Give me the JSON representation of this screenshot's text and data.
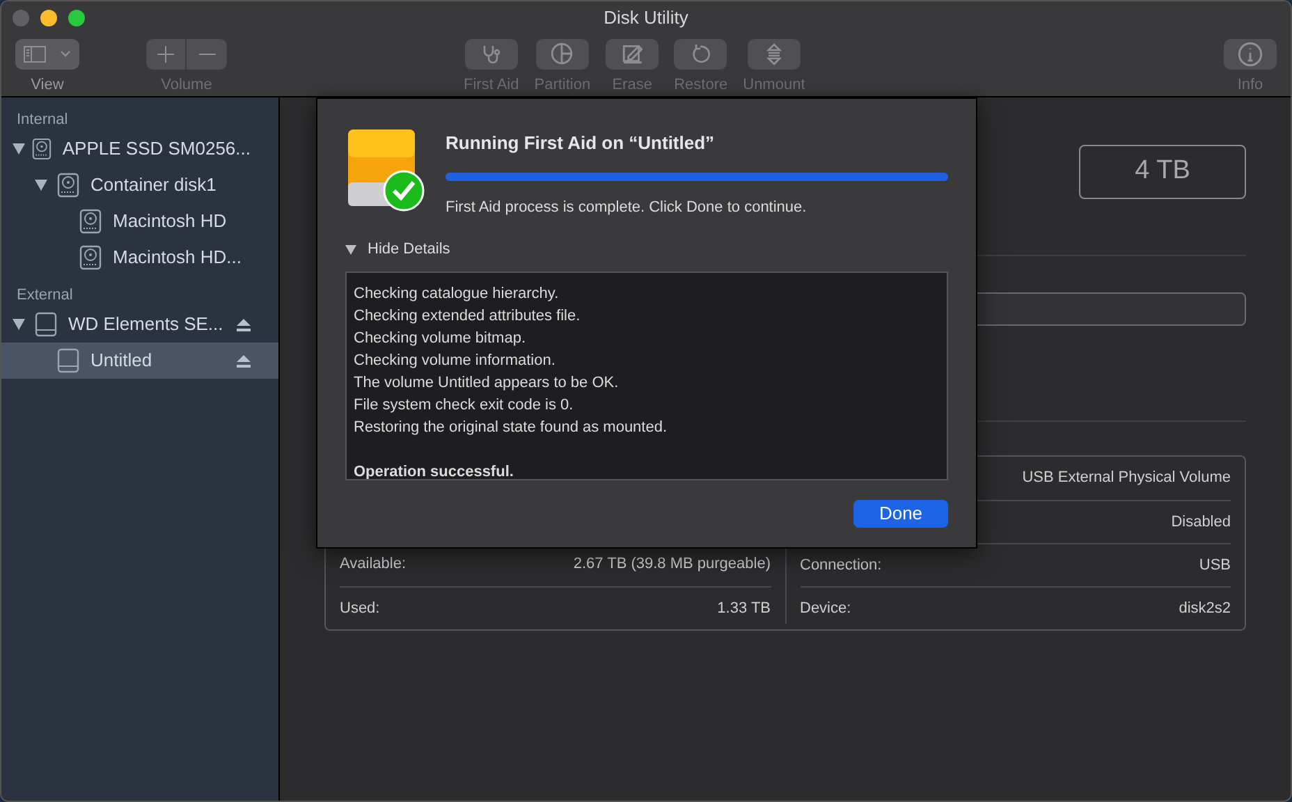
{
  "window": {
    "title": "Disk Utility"
  },
  "toolbar": [
    {
      "kind": "view",
      "label": "View",
      "disabled": false
    },
    {
      "kind": "volume",
      "label": "Volume",
      "disabled": true
    },
    {
      "kind": "firstaid",
      "label": "First Aid",
      "disabled": true
    },
    {
      "kind": "partition",
      "label": "Partition",
      "disabled": true
    },
    {
      "kind": "erase",
      "label": "Erase",
      "disabled": true
    },
    {
      "kind": "restore",
      "label": "Restore",
      "disabled": true
    },
    {
      "kind": "unmount",
      "label": "Unmount",
      "disabled": true
    },
    {
      "kind": "info",
      "label": "Info",
      "disabled": true
    }
  ],
  "sidebar": {
    "sections": [
      {
        "title": "Internal",
        "items": [
          {
            "label": "APPLE SSD SM0256...",
            "kind": "internal",
            "expanded": true,
            "selected": false,
            "eject": false,
            "children": [
              {
                "label": "Container disk1",
                "kind": "internal",
                "expanded": true,
                "selected": false,
                "eject": false,
                "children": [
                  {
                    "label": "Macintosh HD",
                    "kind": "internal",
                    "selected": false,
                    "eject": false
                  },
                  {
                    "label": "Macintosh HD...",
                    "kind": "internal",
                    "selected": false,
                    "eject": false
                  }
                ]
              }
            ]
          }
        ]
      },
      {
        "title": "External",
        "items": [
          {
            "label": "WD Elements SE...",
            "kind": "external",
            "expanded": true,
            "selected": false,
            "eject": true,
            "children": [
              {
                "label": "Untitled",
                "kind": "external",
                "selected": true,
                "eject": true
              }
            ]
          }
        ]
      }
    ]
  },
  "main": {
    "capacity": "4 TB",
    "info_left": [
      {
        "label": "Available:",
        "value": "2.67 TB (39.8 MB purgeable)"
      },
      {
        "label": "Used:",
        "value": "1.33 TB"
      }
    ],
    "info_right": [
      {
        "value": "USB External Physical Volume"
      },
      {
        "value": "Disabled"
      },
      {
        "label": "Connection:",
        "value": "USB"
      },
      {
        "label": "Device:",
        "value": "disk2s2"
      }
    ]
  },
  "dialog": {
    "title": "Running First Aid on “Untitled”",
    "level": 1,
    "message": "First Aid process is complete. Click Done to continue.",
    "details_toggle": "Hide Details",
    "details_expanded": true,
    "log": [
      {
        "text": "Checking catalogue hierarchy.",
        "bold": false
      },
      {
        "text": "Checking extended attributes file.",
        "bold": false
      },
      {
        "text": "Checking volume bitmap.",
        "bold": false
      },
      {
        "text": "Checking volume information.",
        "bold": false
      },
      {
        "text": "The volume Untitled appears to be OK.",
        "bold": false
      },
      {
        "text": "File system check exit code is 0.",
        "bold": false
      },
      {
        "text": "Restoring the original state found as mounted.",
        "bold": false
      },
      {
        "text": "Operation successful.",
        "bold": true
      }
    ],
    "button": "Done"
  }
}
